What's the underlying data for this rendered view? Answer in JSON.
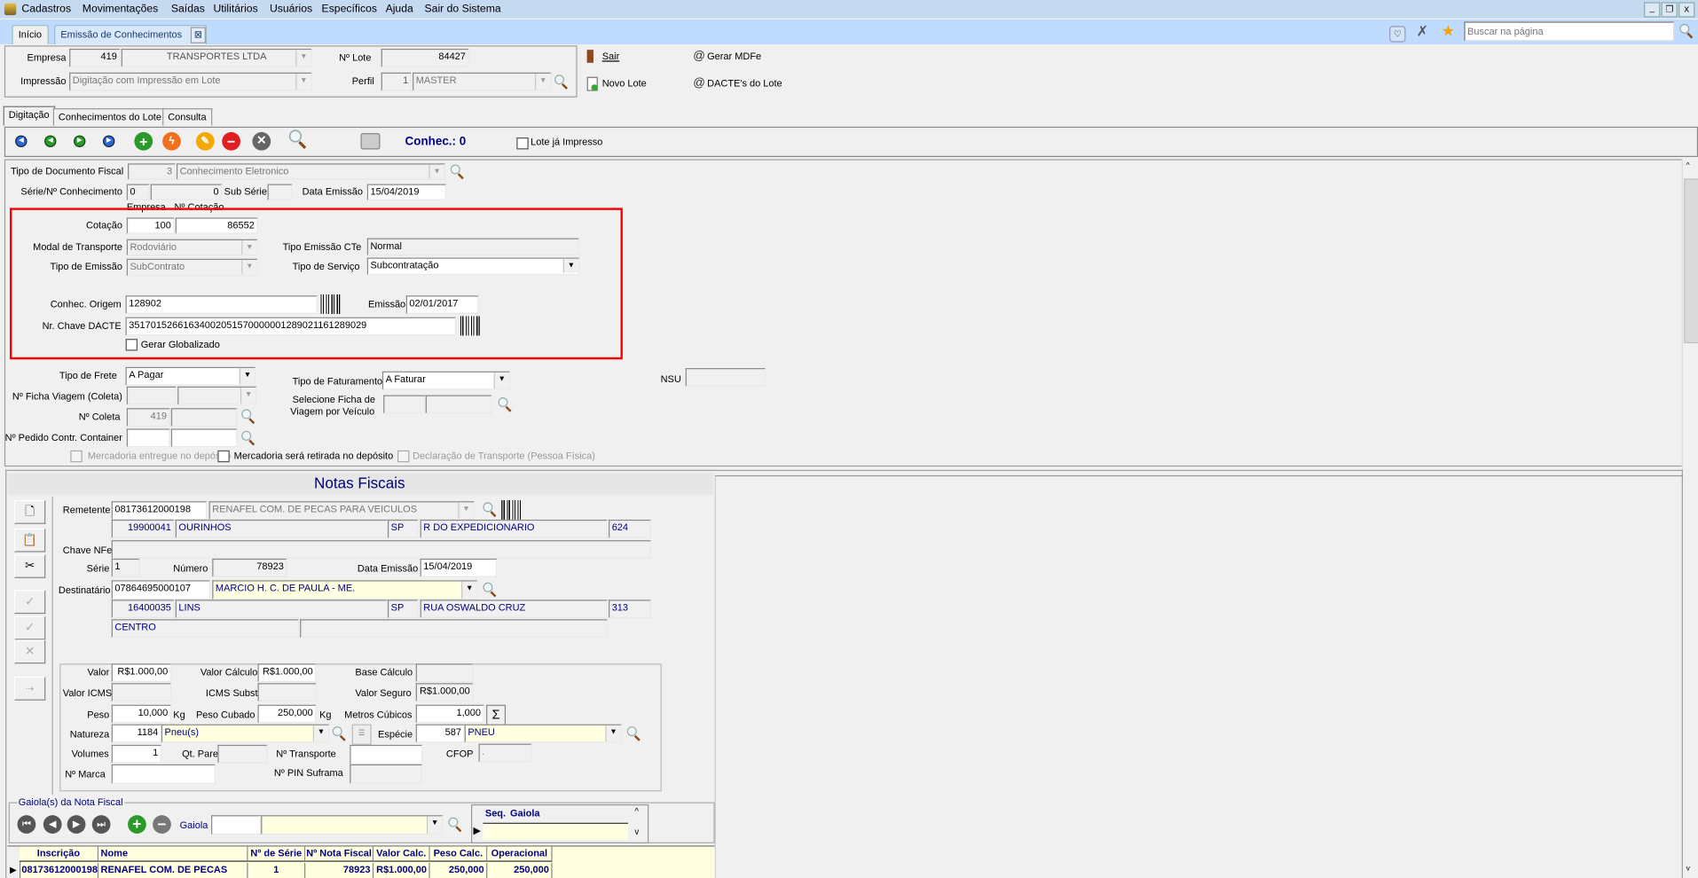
{
  "menu": {
    "items": [
      "Cadastros",
      "Movimentações",
      "Saídas",
      "Utilitários",
      "Usuários",
      "Específicos",
      "Ajuda",
      "Sair do Sistema"
    ]
  },
  "window_buttons": {
    "minimize": "_",
    "restore": "❐",
    "close": "x"
  },
  "tabs": [
    {
      "label": "Início"
    },
    {
      "label": "Emissão de Conhecimentos",
      "close": "⊠"
    }
  ],
  "search": {
    "placeholder": "Buscar na página"
  },
  "header": {
    "empresa_label": "Empresa",
    "empresa_code": "419",
    "empresa_name": "TRANSPORTES LTDA",
    "impressao_label": "Impressão",
    "impressao_value": "Digitação com Impressão em Lote",
    "lote_label": "Nº Lote",
    "lote_value": "84427",
    "perfil_label": "Perfil",
    "perfil_code": "1",
    "perfil_name": "MASTER",
    "actions": {
      "sair": "Sair",
      "novo_lote": "Novo Lote",
      "gerar_mdfe": "Gerar MDFe",
      "dacte_lote": "DACTE's do Lote"
    }
  },
  "subtabs": [
    "Digitação",
    "Conhecimentos do Lote",
    "Consulta"
  ],
  "toolbar": {
    "conhec_label": "Conhec.: 0",
    "lote_impresso": "Lote já Impresso",
    "lote_impresso_checked": false
  },
  "form": {
    "tipo_doc_label": "Tipo de Documento Fiscal",
    "tipo_doc_code": "3",
    "tipo_doc_name": "Conhecimento Eletronico",
    "serie_label": "Série/Nº Conhecimento",
    "serie": "0",
    "numero": "0",
    "sub_serie_label": "Sub Série",
    "sub_serie": "",
    "data_emissao_label": "Data Emissão",
    "data_emissao": "15/04/2019",
    "empresa_caption": "Empresa",
    "cotacao_caption": "Nº Cotação",
    "cotacao_label": "Cotação",
    "cotacao_empresa": "100",
    "cotacao_numero": "86552",
    "modal_label": "Modal de Transporte",
    "modal_value": "Rodoviário",
    "tipo_emissao_cte_label": "Tipo Emissão CTe",
    "tipo_emissao_cte": "Normal",
    "tipo_emissao_label": "Tipo de Emissão",
    "tipo_emissao": "SubContrato",
    "tipo_servico_label": "Tipo de Serviço",
    "tipo_servico": "Subcontratação",
    "conhec_origem_label": "Conhec. Origem",
    "conhec_origem": "128902",
    "emissao_label": "Emissão",
    "emissao": "02/01/2017",
    "chave_label": "Nr. Chave DACTE",
    "chave": "35170152661634002051570000001289021161289029",
    "gerar_globalizado": "Gerar Globalizado",
    "tipo_frete_label": "Tipo de Frete",
    "tipo_frete": "A Pagar",
    "tipo_faturamento_label": "Tipo de Faturamento",
    "tipo_faturamento": "A Faturar",
    "nsu_label": "NSU",
    "nsu": "",
    "ficha_label": "Nº Ficha Viagem (Coleta)",
    "selecione_ficha_1": "Selecione Ficha de",
    "selecione_ficha_2": "Viagem por Veículo",
    "coleta_label": "Nº Coleta",
    "coleta": "419",
    "pedido_label": "Nº Pedido Contr. Container",
    "chk_entregue": "Mercadoria entregue no depósito",
    "chk_retirada": "Mercadoria será retirada no depósito",
    "chk_declaracao": "Declaração de Transporte (Pessoa Física)"
  },
  "notas": {
    "title": "Notas Fiscais",
    "remetente_label": "Remetente",
    "remetente_cnpj": "08173612000198",
    "remetente_nome": "RENAFEL COM. DE PECAS PARA VEICULOS",
    "rem_cep": "19900041",
    "rem_cidade": "OURINHOS",
    "rem_uf": "SP",
    "rem_endereco": "R DO EXPEDICIONARIO",
    "rem_numero": "624",
    "chave_label": "Chave NFe",
    "chave": "",
    "serie_label": "Série",
    "serie": "1",
    "numero_label": "Número",
    "numero": "78923",
    "data_label": "Data Emissão",
    "data": "15/04/2019",
    "dest_label": "Destinatário",
    "dest_cnpj": "07864695000107",
    "dest_nome": "MARCIO H. C. DE PAULA - ME.",
    "dest_cep": "16400035",
    "dest_cidade": "LINS",
    "dest_uf": "SP",
    "dest_endereco": "RUA OSWALDO CRUZ",
    "dest_numero": "313",
    "dest_bairro": "CENTRO",
    "valor_label": "Valor",
    "valor": "R$1.000,00",
    "valor_calc_label": "Valor Cálculo",
    "valor_calc": "R$1.000,00",
    "base_calc_label": "Base Cálculo",
    "valor_icms_label": "Valor ICMS",
    "icms_subst_label": "ICMS Subst",
    "valor_seguro_label": "Valor Seguro",
    "valor_seguro": "R$1.000,00",
    "peso_label": "Peso",
    "peso": "10,000",
    "kg": "Kg",
    "peso_cubado_label": "Peso Cubado",
    "peso_cubado": "250,000",
    "metros_label": "Metros Cúbicos",
    "metros": "1,000",
    "sigma": "Σ",
    "natureza_label": "Natureza",
    "natureza_code": "1184",
    "natureza": "Pneu(s)",
    "especie_label": "Espécie",
    "especie_code": "587",
    "especie": "PNEU",
    "volumes_label": "Volumes",
    "volumes": "1",
    "qt_pares_label": "Qt. Pares",
    "transporte_label": "Nº Transporte",
    "cfop_label": "CFOP",
    "cfop": ".",
    "marca_label": "Nº Marca",
    "pin_label": "Nº PIN Suframa"
  },
  "gaiola": {
    "legend": "Gaiola(s) da Nota Fiscal",
    "label": "Gaiola",
    "grid_headers": [
      "Seq.",
      "Gaiola"
    ]
  },
  "grid": {
    "headers": [
      "Inscrição",
      "Nome",
      "Nº de Série",
      "Nº Nota Fiscal",
      "Valor Calc.",
      "Peso Calc.",
      "Operacional"
    ],
    "rows": [
      [
        "08173612000198",
        "RENAFEL COM. DE PECAS PARA VEICULOS",
        "1",
        "78923",
        "R$1.000,00",
        "250,000",
        "250,000"
      ]
    ]
  },
  "colors": {
    "menu_bg": "#c5d9f1",
    "tabbar_bg": "#bfdbff",
    "highlight_border": "#ff0000",
    "title": "#000080",
    "grid_bg": "#ffffe0"
  }
}
